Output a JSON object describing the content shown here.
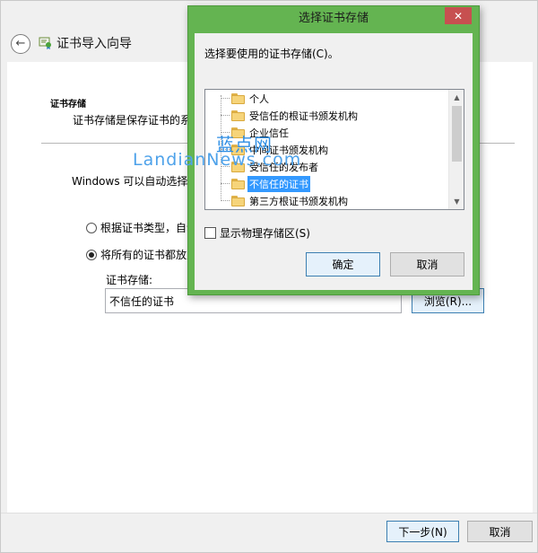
{
  "wizard": {
    "title": "证书导入向导",
    "section_heading": "证书存储",
    "section_desc": "证书存储是保存证书的系统",
    "auto_text": "Windows 可以自动选择证",
    "radio_auto_label": "根据证书类型，自动",
    "radio_manual_label": "将所有的证书都放入",
    "store_label": "证书存储:",
    "store_value": "不信任的证书",
    "browse_label": "浏览(R)...",
    "next_label": "下一步(N)",
    "cancel_label": "取消"
  },
  "dialog": {
    "title": "选择证书存储",
    "close_glyph": "✕",
    "prompt": "选择要使用的证书存储(C)。",
    "tree_items": [
      {
        "label": "个人",
        "selected": false
      },
      {
        "label": "受信任的根证书颁发机构",
        "selected": false
      },
      {
        "label": "企业信任",
        "selected": false
      },
      {
        "label": "中间证书颁发机构",
        "selected": false
      },
      {
        "label": "受信任的发布者",
        "selected": false
      },
      {
        "label": "不信任的证书",
        "selected": true
      },
      {
        "label": "第三方根证书颁发机构",
        "selected": false
      }
    ],
    "scroll_up_glyph": "▲",
    "scroll_down_glyph": "▼",
    "show_physical_label": "显示物理存储区(S)",
    "ok_label": "确定",
    "cancel_label": "取消"
  },
  "watermark": {
    "cn": "蓝点网",
    "en": "LandianNews.com"
  },
  "icons": {
    "back": "arrow-left-icon",
    "wizard": "certificate-icon",
    "folder": "folder-icon",
    "close": "close-icon"
  },
  "colors": {
    "dialog_frame": "#64b451",
    "selection": "#3399ff",
    "close_button": "#c75050",
    "watermark": "#2f8ee3"
  }
}
